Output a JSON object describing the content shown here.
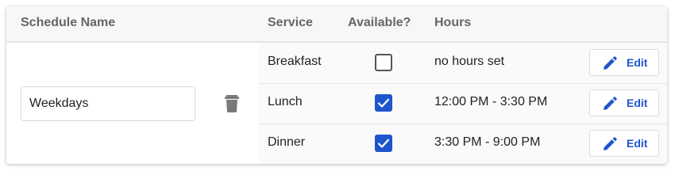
{
  "header": {
    "schedule_name": "Schedule Name",
    "service": "Service",
    "available": "Available?",
    "hours": "Hours"
  },
  "schedule": {
    "name_value": "Weekdays",
    "delete_icon": "trash-icon"
  },
  "rows": [
    {
      "service": "Breakfast",
      "available": false,
      "hours": "no hours set",
      "edit_label": "Edit"
    },
    {
      "service": "Lunch",
      "available": true,
      "hours": "12:00 PM - 3:30 PM",
      "edit_label": "Edit"
    },
    {
      "service": "Dinner",
      "available": true,
      "hours": "3:30 PM - 9:00 PM",
      "edit_label": "Edit"
    }
  ],
  "colors": {
    "accent": "#1f55cc",
    "header_bg": "#f7f7f7",
    "header_text": "#666666"
  }
}
